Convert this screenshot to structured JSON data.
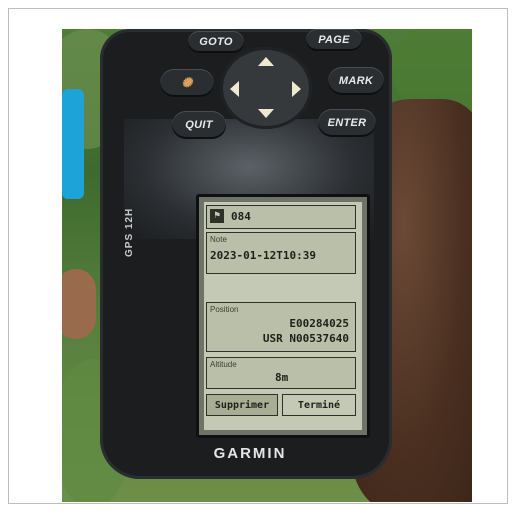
{
  "device": {
    "model": "GPS 12H",
    "brand": "GARMIN",
    "buttons": {
      "goto": "GOTO",
      "page": "PAGE",
      "mark": "MARK",
      "quit": "QUIT",
      "enter": "ENTER"
    }
  },
  "screen": {
    "waypoint_id": "084",
    "note_label": "Note",
    "note_value": "2023-01-12T10:39",
    "position_label": "Position",
    "position_line1": "E00284025",
    "position_line2": "USR N00537640",
    "altitude_label": "Altitude",
    "altitude_value": "8m",
    "delete_label": "Supprimer",
    "done_label": "Terminé"
  }
}
